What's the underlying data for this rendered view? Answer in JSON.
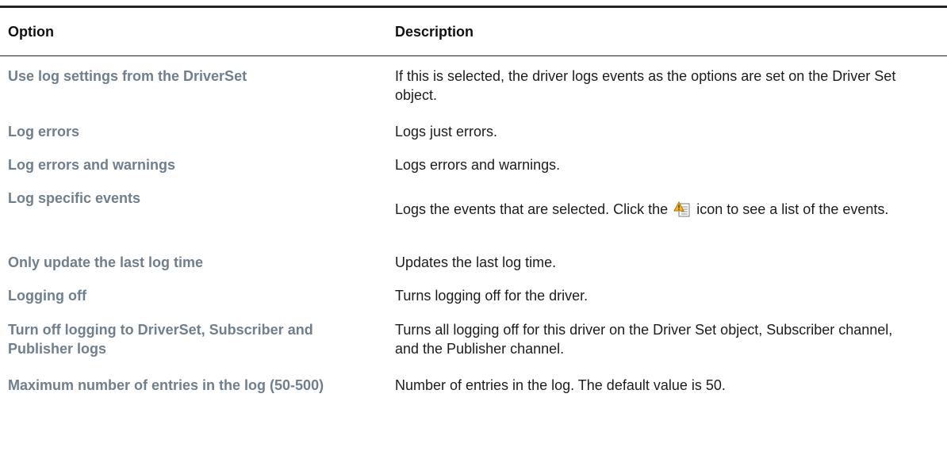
{
  "table": {
    "headers": {
      "option": "Option",
      "description": "Description"
    },
    "rows": [
      {
        "option": "Use log settings from the DriverSet",
        "description": "If this is selected, the driver logs events as the options are set on the Driver Set object."
      },
      {
        "option": "Log errors",
        "description": "Logs just errors."
      },
      {
        "option": "Log errors and warnings",
        "description": "Logs errors and warnings."
      },
      {
        "option": "Log specific events",
        "description_before_icon": "Logs the events that are selected. Click the",
        "icon": "event-list-warning-icon",
        "description_after_icon": "icon to see a list of the events."
      },
      {
        "option": "Only update the last log time",
        "description": "Updates the last log time."
      },
      {
        "option": "Logging off",
        "description": "Turns logging off for the driver."
      },
      {
        "option": "Turn off logging to DriverSet, Subscriber and Publisher logs",
        "description": "Turns all logging off for this driver on the Driver Set object, Subscriber channel, and the Publisher channel."
      },
      {
        "option": "Maximum number of entries in the log (50-500)",
        "description": "Number of entries in the log. The default value is 50."
      }
    ]
  },
  "colors": {
    "option_text": "#6e7f8d",
    "rule": "#222222"
  }
}
